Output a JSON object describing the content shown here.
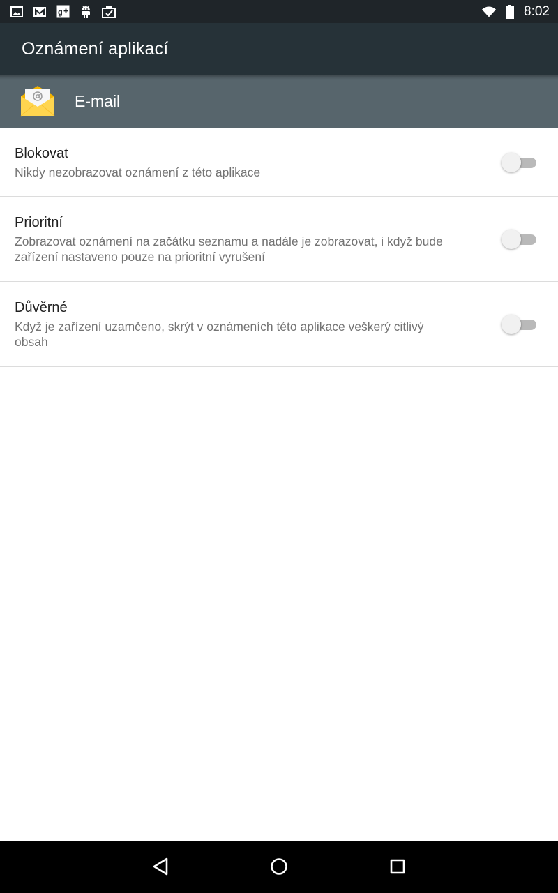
{
  "status_bar": {
    "left_icons": [
      "image-icon",
      "gmail-icon",
      "google-plus-icon",
      "android-icon",
      "clipboard-check-icon"
    ],
    "right_icons": [
      "wifi-icon",
      "battery-icon"
    ],
    "time": "8:02"
  },
  "app_bar": {
    "title": "Oznámení aplikací"
  },
  "app_header": {
    "icon": "email-app-icon",
    "name": "E-mail"
  },
  "settings": [
    {
      "title": "Blokovat",
      "description": "Nikdy nezobrazovat oznámení z této aplikace",
      "enabled": false
    },
    {
      "title": "Prioritní",
      "description": "Zobrazovat oznámení na začátku seznamu a nadále je zobrazovat, i když bude zařízení nastaveno pouze na prioritní vyrušení",
      "enabled": false
    },
    {
      "title": "Důvěrné",
      "description": "Když je zařízení uzamčeno, skrýt v oznámeních této aplikace veškerý citlivý obsah",
      "enabled": false
    }
  ],
  "nav_bar": {
    "buttons": [
      "back-icon",
      "home-icon",
      "recents-icon"
    ]
  },
  "colors": {
    "status_bar": "#1f2529",
    "app_bar": "#263238",
    "app_header": "#57656c",
    "switch_off_track": "#b9b9b9",
    "switch_off_thumb": "#f1f1f1"
  }
}
